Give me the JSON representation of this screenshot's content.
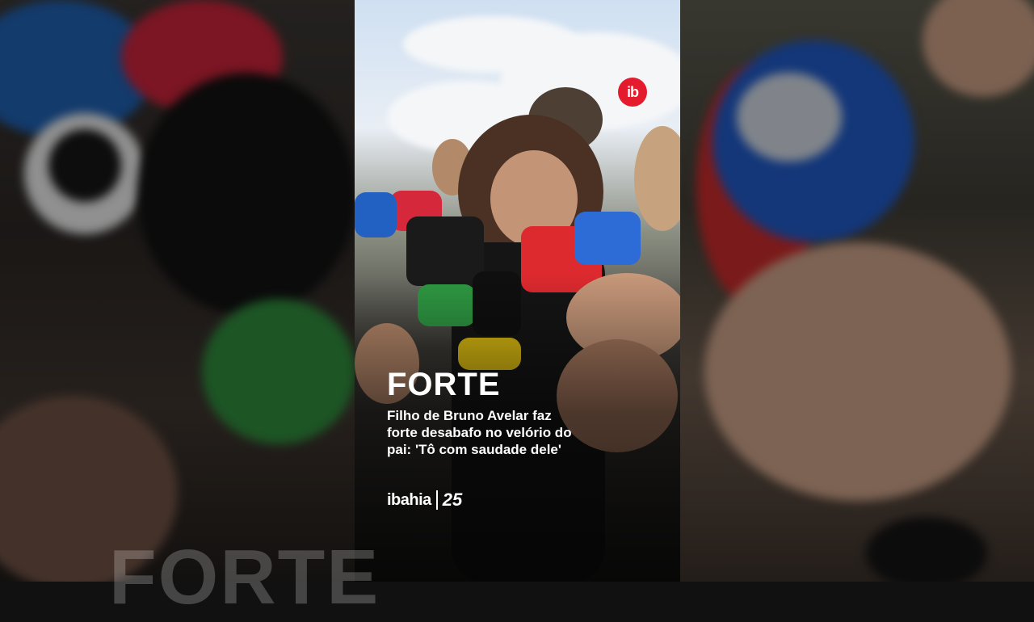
{
  "overlay": {
    "badge": "ib",
    "headline": "FORTE",
    "subtitle": "Filho de Bruno Avelar faz forte desabafo no velório do pai: 'Tô com saudade dele'",
    "background_headline": "FORTE"
  },
  "branding": {
    "name": "ibahia",
    "mark": "25"
  },
  "colors": {
    "brand_red": "#e31b2d",
    "text": "#ffffff"
  },
  "icons": [
    "ib-logo-icon",
    "ibahia-25-logo-icon"
  ]
}
